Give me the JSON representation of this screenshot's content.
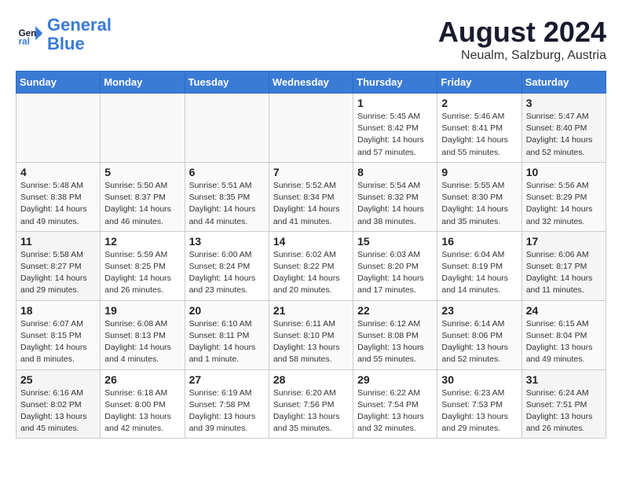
{
  "header": {
    "logo_line1": "General",
    "logo_line2": "Blue",
    "month_year": "August 2024",
    "location": "Neualm, Salzburg, Austria"
  },
  "weekdays": [
    "Sunday",
    "Monday",
    "Tuesday",
    "Wednesday",
    "Thursday",
    "Friday",
    "Saturday"
  ],
  "weeks": [
    [
      {
        "day": "",
        "info": ""
      },
      {
        "day": "",
        "info": ""
      },
      {
        "day": "",
        "info": ""
      },
      {
        "day": "",
        "info": ""
      },
      {
        "day": "1",
        "info": "Sunrise: 5:45 AM\nSunset: 8:42 PM\nDaylight: 14 hours\nand 57 minutes."
      },
      {
        "day": "2",
        "info": "Sunrise: 5:46 AM\nSunset: 8:41 PM\nDaylight: 14 hours\nand 55 minutes."
      },
      {
        "day": "3",
        "info": "Sunrise: 5:47 AM\nSunset: 8:40 PM\nDaylight: 14 hours\nand 52 minutes."
      }
    ],
    [
      {
        "day": "4",
        "info": "Sunrise: 5:48 AM\nSunset: 8:38 PM\nDaylight: 14 hours\nand 49 minutes."
      },
      {
        "day": "5",
        "info": "Sunrise: 5:50 AM\nSunset: 8:37 PM\nDaylight: 14 hours\nand 46 minutes."
      },
      {
        "day": "6",
        "info": "Sunrise: 5:51 AM\nSunset: 8:35 PM\nDaylight: 14 hours\nand 44 minutes."
      },
      {
        "day": "7",
        "info": "Sunrise: 5:52 AM\nSunset: 8:34 PM\nDaylight: 14 hours\nand 41 minutes."
      },
      {
        "day": "8",
        "info": "Sunrise: 5:54 AM\nSunset: 8:32 PM\nDaylight: 14 hours\nand 38 minutes."
      },
      {
        "day": "9",
        "info": "Sunrise: 5:55 AM\nSunset: 8:30 PM\nDaylight: 14 hours\nand 35 minutes."
      },
      {
        "day": "10",
        "info": "Sunrise: 5:56 AM\nSunset: 8:29 PM\nDaylight: 14 hours\nand 32 minutes."
      }
    ],
    [
      {
        "day": "11",
        "info": "Sunrise: 5:58 AM\nSunset: 8:27 PM\nDaylight: 14 hours\nand 29 minutes."
      },
      {
        "day": "12",
        "info": "Sunrise: 5:59 AM\nSunset: 8:25 PM\nDaylight: 14 hours\nand 26 minutes."
      },
      {
        "day": "13",
        "info": "Sunrise: 6:00 AM\nSunset: 8:24 PM\nDaylight: 14 hours\nand 23 minutes."
      },
      {
        "day": "14",
        "info": "Sunrise: 6:02 AM\nSunset: 8:22 PM\nDaylight: 14 hours\nand 20 minutes."
      },
      {
        "day": "15",
        "info": "Sunrise: 6:03 AM\nSunset: 8:20 PM\nDaylight: 14 hours\nand 17 minutes."
      },
      {
        "day": "16",
        "info": "Sunrise: 6:04 AM\nSunset: 8:19 PM\nDaylight: 14 hours\nand 14 minutes."
      },
      {
        "day": "17",
        "info": "Sunrise: 6:06 AM\nSunset: 8:17 PM\nDaylight: 14 hours\nand 11 minutes."
      }
    ],
    [
      {
        "day": "18",
        "info": "Sunrise: 6:07 AM\nSunset: 8:15 PM\nDaylight: 14 hours\nand 8 minutes."
      },
      {
        "day": "19",
        "info": "Sunrise: 6:08 AM\nSunset: 8:13 PM\nDaylight: 14 hours\nand 4 minutes."
      },
      {
        "day": "20",
        "info": "Sunrise: 6:10 AM\nSunset: 8:11 PM\nDaylight: 14 hours\nand 1 minute."
      },
      {
        "day": "21",
        "info": "Sunrise: 6:11 AM\nSunset: 8:10 PM\nDaylight: 13 hours\nand 58 minutes."
      },
      {
        "day": "22",
        "info": "Sunrise: 6:12 AM\nSunset: 8:08 PM\nDaylight: 13 hours\nand 55 minutes."
      },
      {
        "day": "23",
        "info": "Sunrise: 6:14 AM\nSunset: 8:06 PM\nDaylight: 13 hours\nand 52 minutes."
      },
      {
        "day": "24",
        "info": "Sunrise: 6:15 AM\nSunset: 8:04 PM\nDaylight: 13 hours\nand 49 minutes."
      }
    ],
    [
      {
        "day": "25",
        "info": "Sunrise: 6:16 AM\nSunset: 8:02 PM\nDaylight: 13 hours\nand 45 minutes."
      },
      {
        "day": "26",
        "info": "Sunrise: 6:18 AM\nSunset: 8:00 PM\nDaylight: 13 hours\nand 42 minutes."
      },
      {
        "day": "27",
        "info": "Sunrise: 6:19 AM\nSunset: 7:58 PM\nDaylight: 13 hours\nand 39 minutes."
      },
      {
        "day": "28",
        "info": "Sunrise: 6:20 AM\nSunset: 7:56 PM\nDaylight: 13 hours\nand 35 minutes."
      },
      {
        "day": "29",
        "info": "Sunrise: 6:22 AM\nSunset: 7:54 PM\nDaylight: 13 hours\nand 32 minutes."
      },
      {
        "day": "30",
        "info": "Sunrise: 6:23 AM\nSunset: 7:53 PM\nDaylight: 13 hours\nand 29 minutes."
      },
      {
        "day": "31",
        "info": "Sunrise: 6:24 AM\nSunset: 7:51 PM\nDaylight: 13 hours\nand 26 minutes."
      }
    ]
  ]
}
